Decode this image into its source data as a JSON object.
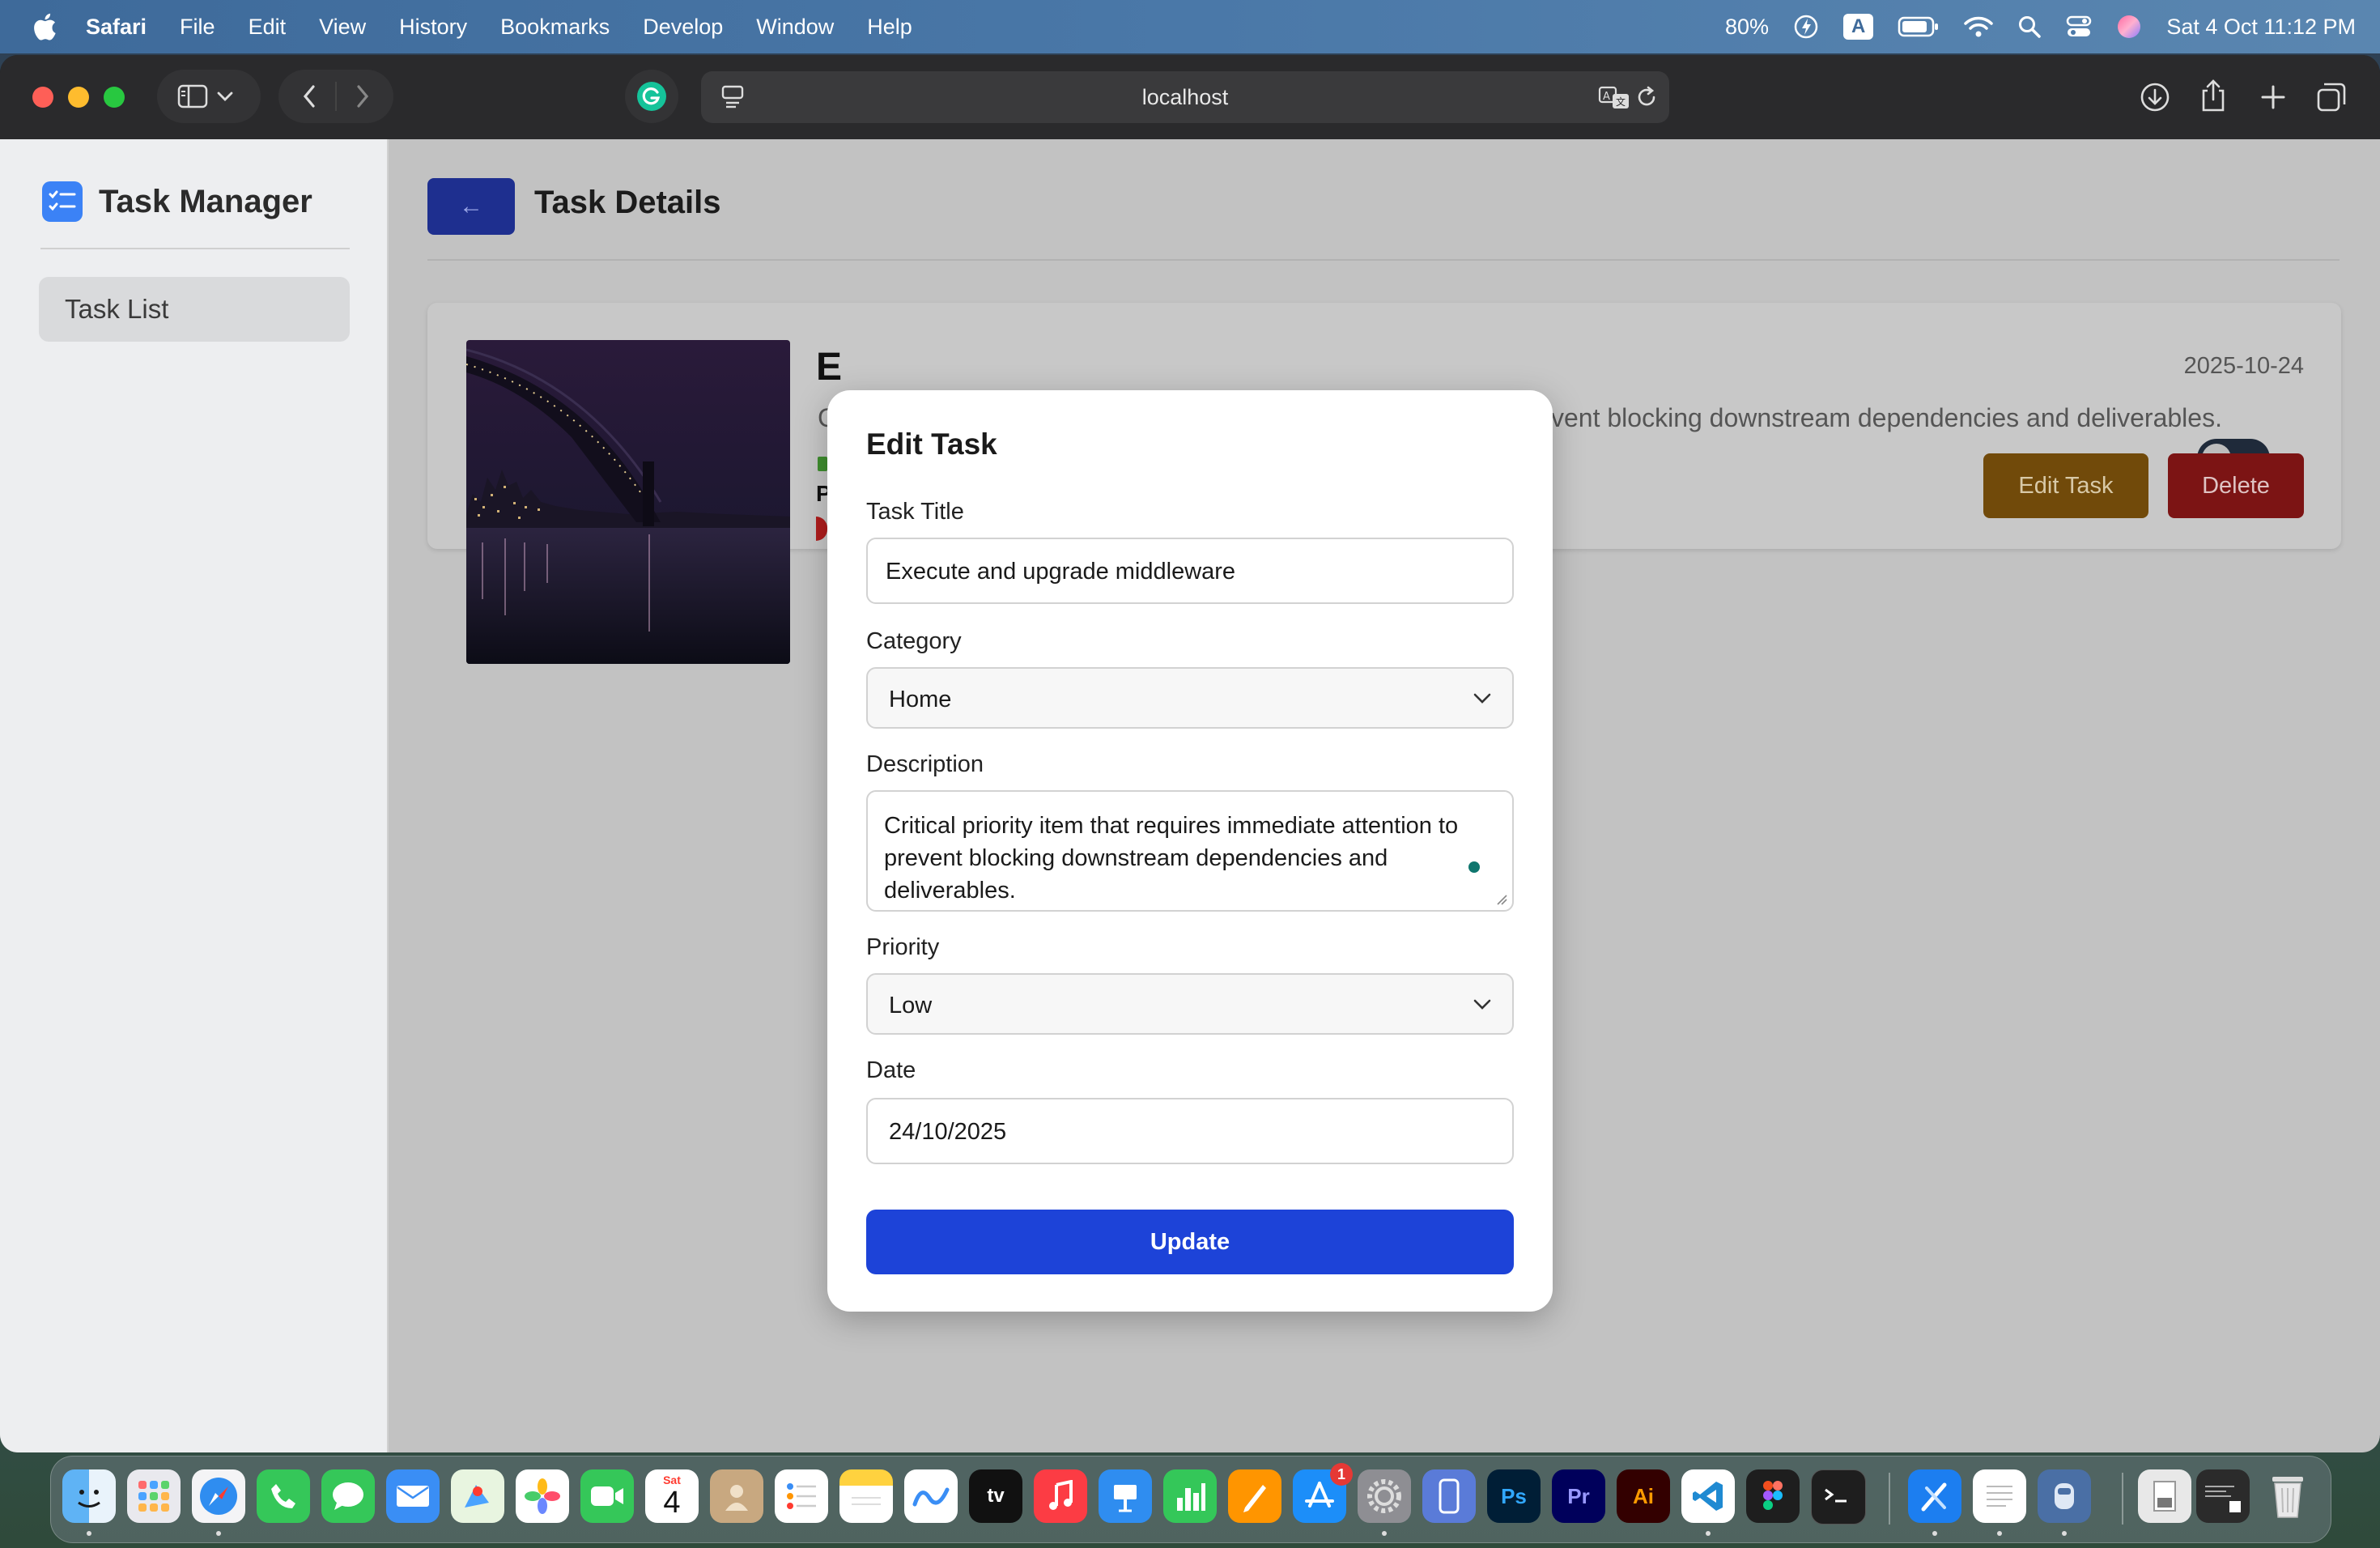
{
  "menubar": {
    "app": "Safari",
    "items": [
      "File",
      "Edit",
      "View",
      "History",
      "Bookmarks",
      "Develop",
      "Window",
      "Help"
    ],
    "battery": "80%",
    "input_source": "A",
    "datetime": "Sat 4 Oct  11:12 PM"
  },
  "browser": {
    "address": "localhost"
  },
  "sidebar": {
    "brand": "Task Manager",
    "items": [
      {
        "label": "Task List"
      }
    ]
  },
  "main": {
    "back_label": "←",
    "title": "Task Details",
    "card": {
      "date": "2025-10-24",
      "description_visible": "vent blocking downstream dependencies and deliverables.",
      "title_glyph": "E",
      "description_glyph": "C",
      "priority_glyph": "P",
      "edit_label": "Edit Task",
      "delete_label": "Delete",
      "toggle_on": false
    }
  },
  "modal": {
    "title": "Edit Task",
    "title_label": "Task Title",
    "title_value": "Execute and upgrade middleware",
    "category_label": "Category",
    "category_value": "Home",
    "description_label": "Description",
    "description_value": "Critical priority item that requires immediate attention to prevent blocking downstream dependencies and deliverables.",
    "priority_label": "Priority",
    "priority_value": "Low",
    "date_label": "Date",
    "date_value": "24/10/2025",
    "update_label": "Update"
  },
  "dock": {
    "calendar_month": "Sat",
    "calendar_day": "4",
    "appstore_badge": "1",
    "apps": [
      "Finder",
      "Launchpad",
      "Safari",
      "Phone",
      "Messages",
      "Mail",
      "Maps",
      "Photos",
      "FaceTime",
      "Calendar",
      "Contacts",
      "Reminders",
      "Notes",
      "Freeform",
      "TV",
      "Music",
      "Keynote",
      "Numbers",
      "Pages",
      "App Store",
      "System Settings",
      "iPhone Mirroring",
      "Ps",
      "Pr",
      "Ai",
      "VS Code",
      "Figma",
      "Terminal",
      "Xcode",
      "TextEdit",
      "Other",
      "Preview",
      "Screenshot",
      "Trash"
    ]
  },
  "colors": {
    "accent": "#1d43d8",
    "edit_button": "#714a0a",
    "delete_button": "#7c1414",
    "brand_logo": "#3b82f6"
  }
}
